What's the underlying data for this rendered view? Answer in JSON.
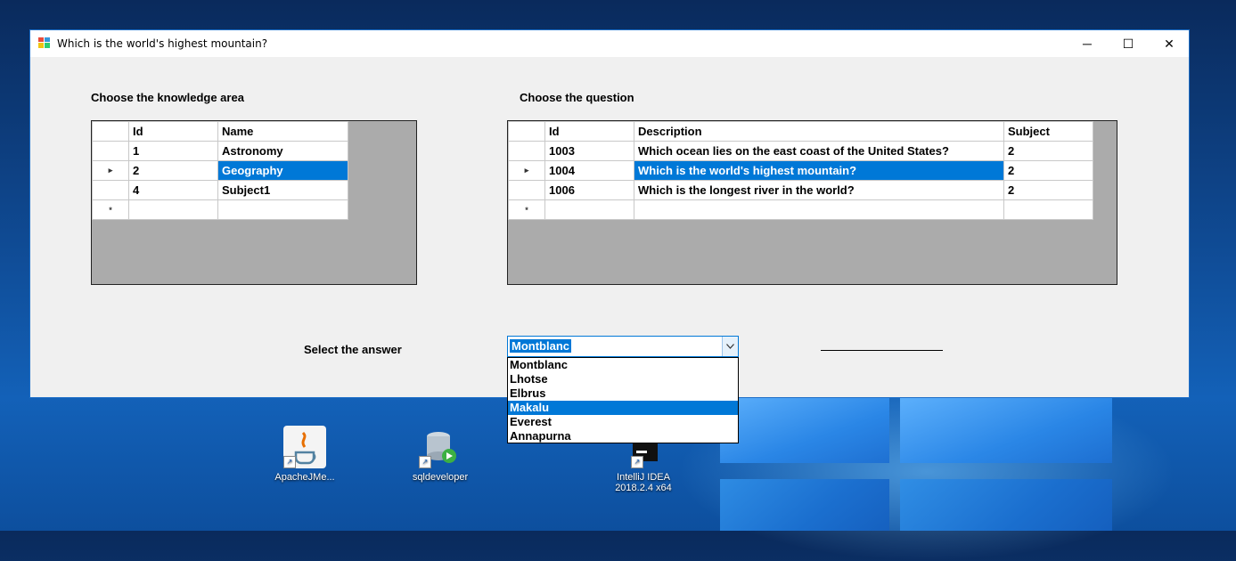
{
  "window": {
    "title": "Which is the world's highest mountain?",
    "controls": {
      "minimize": "─",
      "maximize": "☐",
      "close": "✕"
    }
  },
  "knowledge": {
    "label": "Choose the knowledge area",
    "columns": [
      "Id",
      "Name"
    ],
    "rows": [
      {
        "id": "1",
        "name": "Astronomy",
        "selected": false
      },
      {
        "id": "2",
        "name": "Geography",
        "selected": true
      },
      {
        "id": "4",
        "name": "Subject1",
        "selected": false
      }
    ]
  },
  "question": {
    "label": "Choose the question",
    "columns": [
      "Id",
      "Description",
      "Subject"
    ],
    "rows": [
      {
        "id": "1003",
        "description": "Which ocean lies on the east coast of the United States?",
        "subject": "2",
        "selected": false
      },
      {
        "id": "1004",
        "description": "Which is the world's highest mountain?",
        "subject": "2",
        "selected": true
      },
      {
        "id": "1006",
        "description": "Which is the longest river in the world?",
        "subject": "2",
        "selected": false
      }
    ]
  },
  "answer": {
    "label": "Select the answer",
    "selected": "Montblanc",
    "highlighted": "Makalu",
    "options": [
      "Montblanc",
      "Lhotse",
      "Elbrus",
      "Makalu",
      "Everest",
      "Annapurna"
    ],
    "result_text": ""
  },
  "desktop": {
    "icons": [
      {
        "name": "jmeter",
        "label": "ApacheJMe..."
      },
      {
        "name": "sqldeveloper",
        "label": "sqldeveloper"
      },
      {
        "name": "intellij",
        "label1": "IntelliJ IDEA",
        "label2": "2018.2.4 x64"
      }
    ]
  },
  "colors": {
    "selection": "#0078d7",
    "window_bg": "#f0f0f0",
    "grid_bg": "#ababab"
  },
  "row_markers": {
    "current": "▸",
    "new": "*"
  }
}
